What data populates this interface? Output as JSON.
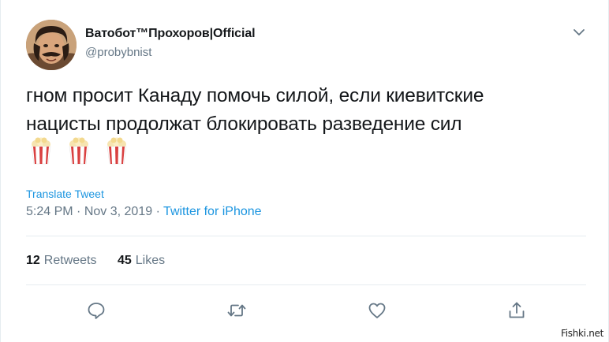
{
  "tweet": {
    "display_name": "Ватобот™Прохоров|Official",
    "handle": "@probybnist",
    "text_line_1": "гном просит Канаду помочь силой, если киевитские",
    "text_line_2": "нацисты продолжат блокировать разведение сил",
    "emojis": [
      "popcorn-emoji",
      "popcorn-emoji",
      "popcorn-emoji"
    ],
    "translate_label": "Translate Tweet",
    "time": "5:24 PM",
    "separator": "·",
    "date": "Nov 3, 2019",
    "source": "Twitter for iPhone"
  },
  "stats": {
    "retweets_count": "12",
    "retweets_label": "Retweets",
    "likes_count": "45",
    "likes_label": "Likes"
  },
  "actions": [
    "reply-icon",
    "retweet-icon",
    "like-icon",
    "share-icon"
  ],
  "watermark": "Fishki.net",
  "colors": {
    "text": "#14171a",
    "secondary": "#657786",
    "link": "#1b95e0",
    "divider": "#e6ecf0"
  }
}
